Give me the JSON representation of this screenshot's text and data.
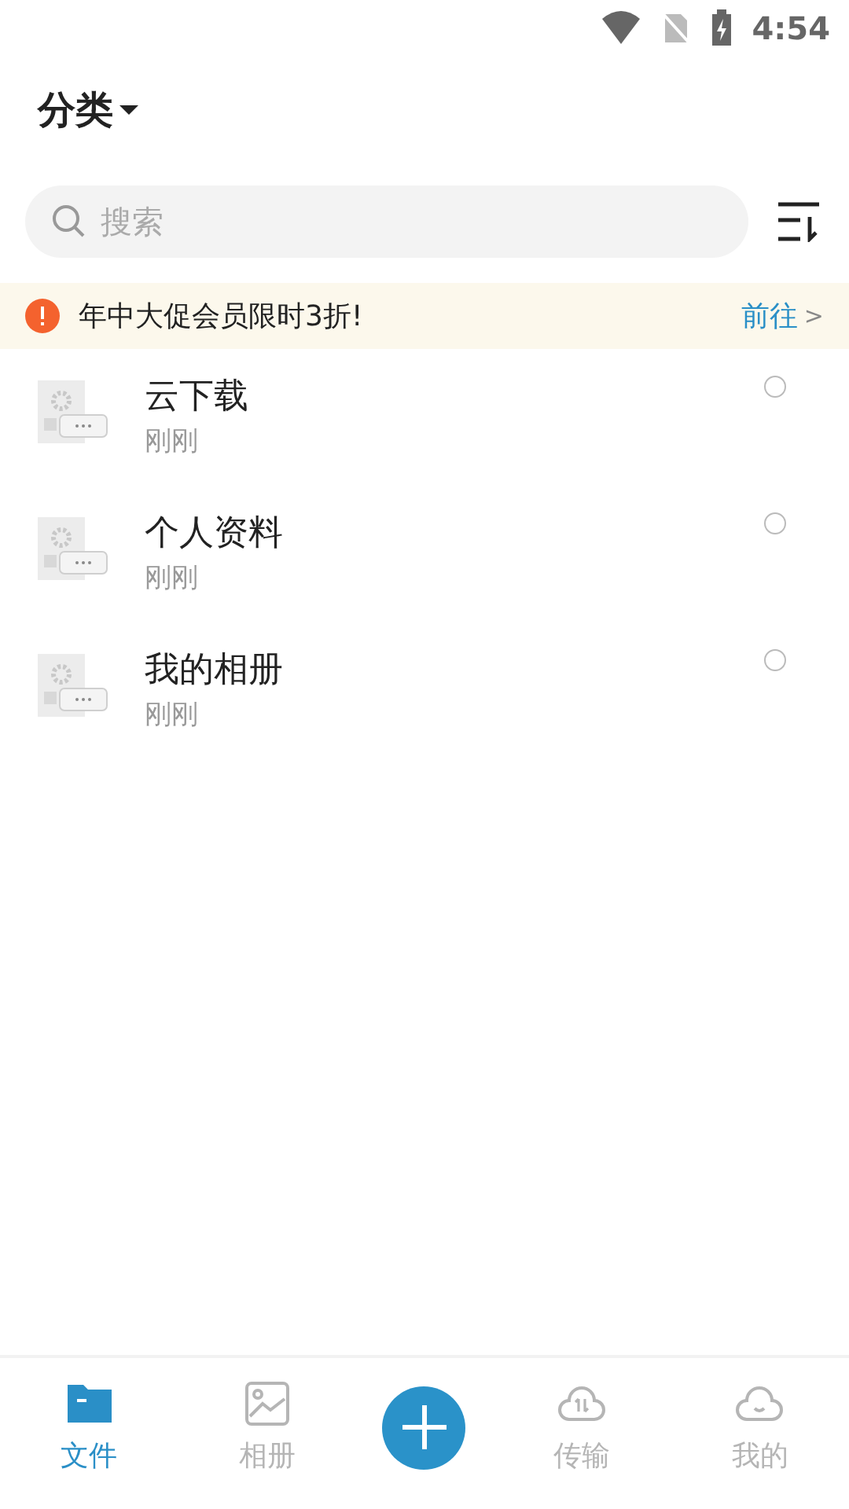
{
  "status_bar": {
    "time": "4:54"
  },
  "header": {
    "title": "分类"
  },
  "search": {
    "placeholder": "搜索"
  },
  "banner": {
    "text": "年中大促会员限时3折!",
    "link": "前往",
    "arrow": ">"
  },
  "files": [
    {
      "name": "云下载",
      "time": "刚刚",
      "selected": false
    },
    {
      "name": "个人资料",
      "time": "刚刚",
      "selected": false
    },
    {
      "name": "我的相册",
      "time": "刚刚",
      "selected": false
    }
  ],
  "tabs": [
    {
      "kind": "files",
      "label": "文件",
      "selected": true
    },
    {
      "kind": "album",
      "label": "相册",
      "selected": false
    },
    {
      "kind": "add"
    },
    {
      "kind": "transfer",
      "label": "传输",
      "selected": false
    },
    {
      "kind": "mine",
      "label": "我的",
      "selected": false
    }
  ]
}
